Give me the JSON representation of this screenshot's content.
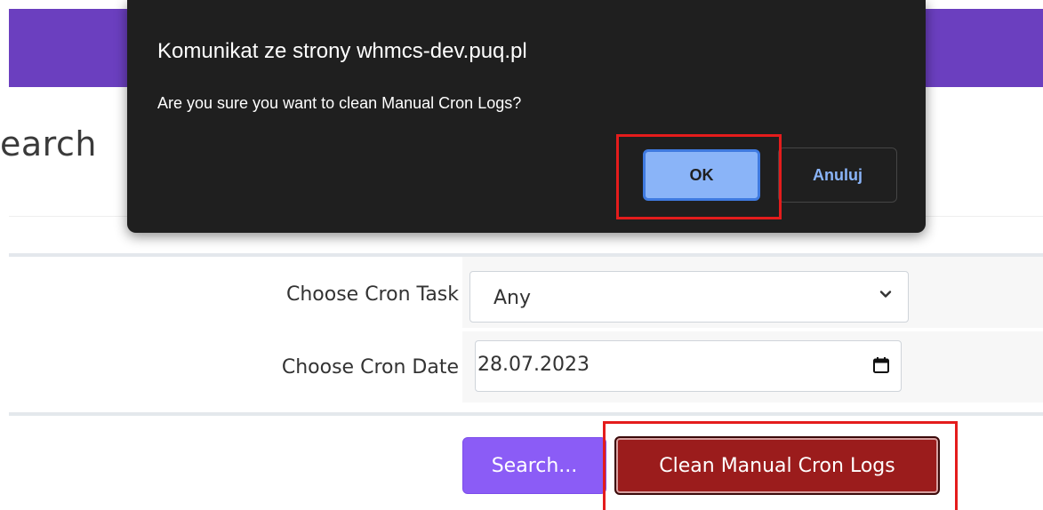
{
  "page": {
    "title_partial": "earch"
  },
  "form": {
    "cron_task_label": "Choose Cron Task",
    "cron_task_value": "Any",
    "cron_date_label": "Choose Cron Date",
    "cron_date_value": "28.07.2023"
  },
  "actions": {
    "search_label": "Search...",
    "clean_label": "Clean Manual Cron Logs"
  },
  "dialog": {
    "title": "Komunikat ze strony whmcs-dev.puq.pl",
    "message": "Are you sure you want to clean Manual Cron Logs?",
    "ok_label": "OK",
    "cancel_label": "Anuluj"
  },
  "colors": {
    "topbar": "#6b3fbf",
    "search_button": "#8b5cf6",
    "clean_button": "#9b1c1c",
    "dialog_bg": "#1f1f1f",
    "ok_button": "#8ab4f8",
    "highlight": "#e41c1c"
  },
  "icons": {
    "select_arrow": "chevron-down-icon",
    "date_picker": "calendar-icon"
  }
}
